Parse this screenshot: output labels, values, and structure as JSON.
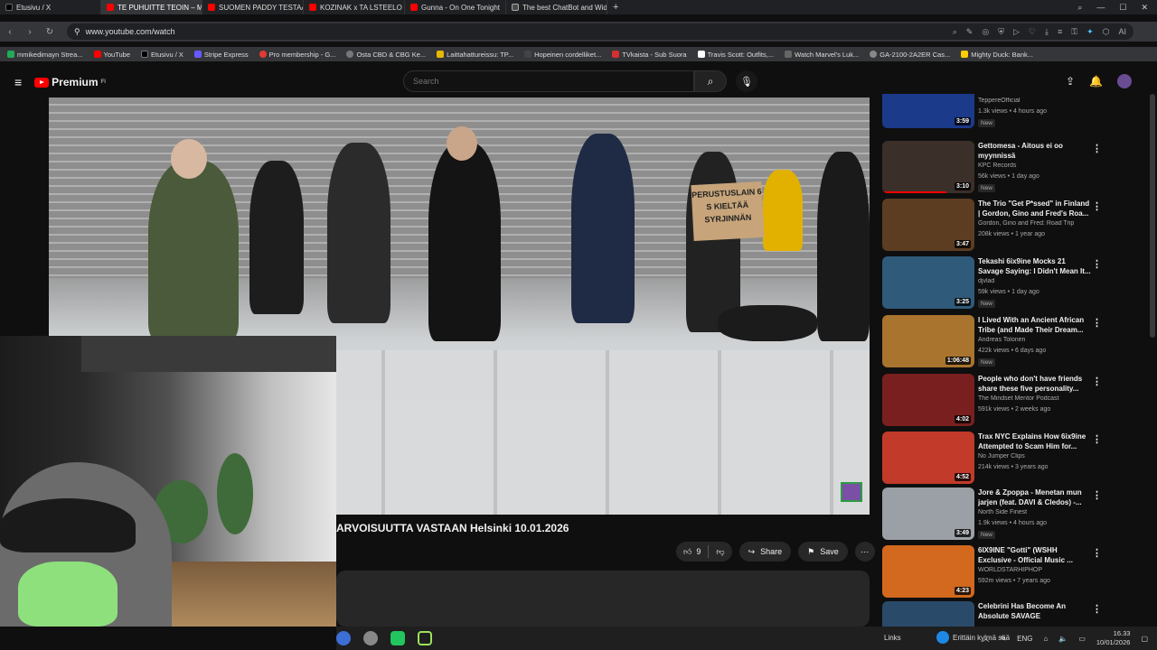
{
  "browser": {
    "tabs": [
      {
        "label": "Etusivu / X",
        "color": "#000000",
        "active": false
      },
      {
        "label": "TE PUHUITTE TEOIN – Mi",
        "color": "#ff0000",
        "active": true
      },
      {
        "label": "SUOMEN PADDY TESTAA",
        "color": "#ff0000",
        "active": false
      },
      {
        "label": "KOZINAK x TA LSTEELO -",
        "color": "#ff0000",
        "active": false
      },
      {
        "label": "Gunna - On One Tonight",
        "color": "#ff0000",
        "active": false
      },
      {
        "label": "The best ChatBot and Wid",
        "color": "#4a4a4a",
        "active": false
      }
    ],
    "new_tab": "+",
    "url": "www.youtube.com/watch",
    "bookmarks": [
      {
        "label": "mmikedimayn Strea...",
        "color": "#22aa55"
      },
      {
        "label": "YouTube",
        "color": "#ff0000"
      },
      {
        "label": "Etusivu / X",
        "color": "#000000"
      },
      {
        "label": "Stripe Express",
        "color": "#635bff"
      },
      {
        "label": "Pro membership - G...",
        "color": "#e53935"
      },
      {
        "label": "Osta CBD & CBG Ke...",
        "color": "#777777"
      },
      {
        "label": "Laittahattureissu: TP...",
        "color": "#e6b800"
      },
      {
        "label": "Hopeinen cordelliket...",
        "color": "#444444"
      },
      {
        "label": "TVkaista - Sub Suora",
        "color": "#d32f2f"
      },
      {
        "label": "Travis Scott: Outfits,...",
        "color": "#ffffff"
      },
      {
        "label": "Watch Marvel's Luk...",
        "color": "#666666"
      },
      {
        "label": "GA-2100-2A2ER Cas...",
        "color": "#888888"
      },
      {
        "label": "Mighty Duck: Bank...",
        "color": "#ffcc00"
      }
    ]
  },
  "youtube": {
    "logo": "Premium",
    "logo_sup": "FI",
    "search_placeholder": "Search"
  },
  "video": {
    "title": "ARVOISUUTTA VASTAAN Helsinki 10.01.2026",
    "sign_text": "PERUSTUSLAIN 6 S KIELTÄÄ SYRJINNÄN",
    "likes": "9",
    "share": "Share",
    "save": "Save"
  },
  "recommendations": [
    {
      "title": "",
      "channel": "TeppereOfficial",
      "meta": "1.3k views • 4 hours ago",
      "badge": "New",
      "duration": "3:59",
      "thumb": "#1b3a8a"
    },
    {
      "title": "Gettomesa - Aitous ei oo myynnissä",
      "channel": "KPC Records",
      "meta": "56k views • 1 day ago",
      "badge": "New",
      "duration": "3:10",
      "thumb": "#3b2f2a"
    },
    {
      "title": "The Trio \"Get P*ssed\" in Finland | Gordon, Gino and Fred's Roa...",
      "channel": "Gordon, Gino and Fred: Road Trip",
      "meta": "208k views • 1 year ago",
      "badge": "",
      "duration": "3:47",
      "thumb": "#5c3d22"
    },
    {
      "title": "Tekashi 6ix9ine Mocks 21 Savage Saying: I Didn't Mean It...",
      "channel": "djvlad",
      "meta": "59k views • 1 day ago",
      "badge": "New",
      "duration": "3:25",
      "thumb": "#2f5a7a"
    },
    {
      "title": "I Lived With an Ancient African Tribe (and Made Their Dream...",
      "channel": "Andreas Tolonen",
      "meta": "422k views • 6 days ago",
      "badge": "New",
      "duration": "1:06:48",
      "thumb": "#a8742e"
    },
    {
      "title": "People who don't have friends share these five personality...",
      "channel": "The Mindset Mentor Podcast",
      "meta": "591k views • 2 weeks ago",
      "badge": "",
      "duration": "4:02",
      "thumb": "#7a1f1f"
    },
    {
      "title": "Trax NYC Explains How 6ix9ine Attempted to Scam Him for...",
      "channel": "No Jumper Clips",
      "meta": "214k views • 3 years ago",
      "badge": "",
      "duration": "4:52",
      "thumb": "#c23a2a"
    },
    {
      "title": "Jore & Zpoppa - Menetan mun jarjen (feat. DAVI & Cledos) -...",
      "channel": "North Side Finest",
      "meta": "1.9k views • 4 hours ago",
      "badge": "New",
      "duration": "3:49",
      "thumb": "#9aa0a6"
    },
    {
      "title": "6IX9INE \"Gotti\" (WSHH Exclusive - Official Music ...",
      "channel": "WORLDSTARHIPHOP",
      "meta": "592m views • 7 years ago",
      "badge": "",
      "duration": "4:23",
      "thumb": "#d2691e"
    },
    {
      "title": "Celebrini Has Become An Absolute SAVAGE",
      "channel": "",
      "meta": "",
      "badge": "",
      "duration": "",
      "thumb": "#2a4a6a"
    }
  ],
  "taskbar": {
    "links": "Links",
    "weather": "Erittäin kylmä sää",
    "lang": "ENG",
    "time": "16.33",
    "date": "10/01/2026"
  },
  "colors": {
    "yt_red": "#ff0000",
    "background": "#0f0f0f"
  }
}
